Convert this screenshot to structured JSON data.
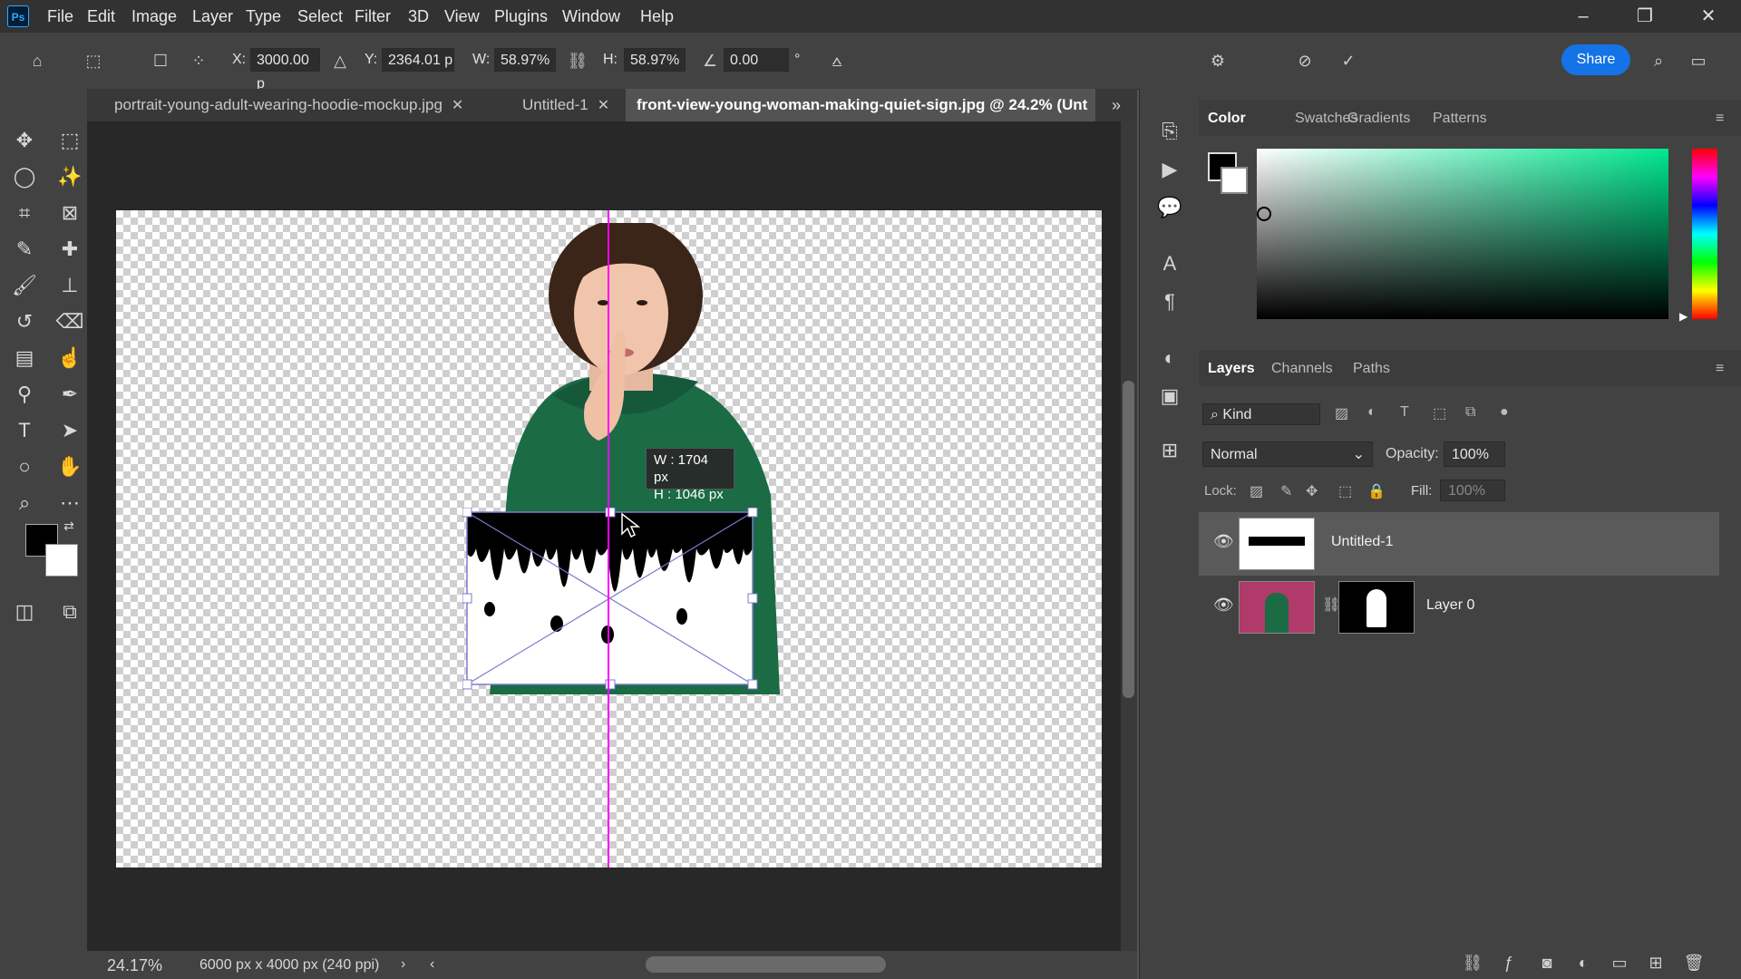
{
  "app": {
    "logo": "Ps"
  },
  "menu": [
    "File",
    "Edit",
    "Image",
    "Layer",
    "Type",
    "Select",
    "Filter",
    "3D",
    "View",
    "Plugins",
    "Window",
    "Help"
  ],
  "window_controls": {
    "minimize": "–",
    "restore": "❐",
    "close": "✕"
  },
  "options": {
    "x_label": "X:",
    "x_value": "3000.00 p",
    "y_label": "Y:",
    "y_value": "2364.01 p",
    "w_label": "W:",
    "w_value": "58.97%",
    "h_label": "H:",
    "h_value": "58.97%",
    "angle_value": "0.00",
    "degree": "°",
    "share": "Share"
  },
  "tabs": [
    {
      "label": "portrait-young-adult-wearing-hoodie-mockup.jpg",
      "close": "✕"
    },
    {
      "label": "Untitled-1",
      "close": "✕"
    },
    {
      "label": "front-view-young-woman-making-quiet-sign.jpg @ 24.2% (Unt"
    }
  ],
  "canvas": {
    "tooltip_w": "W :  1704 px",
    "tooltip_h": "H :  1046 px"
  },
  "status": {
    "zoom": "24.17%",
    "doc_info": "6000 px x 4000 px (240 ppi)"
  },
  "color_panel": {
    "tabs": [
      "Color",
      "Swatches",
      "Gradients",
      "Patterns"
    ]
  },
  "layers_panel": {
    "tabs": [
      "Layers",
      "Channels",
      "Paths"
    ],
    "kind_placeholder": "Kind",
    "blend_mode": "Normal",
    "opacity_label": "Opacity:",
    "opacity_value": "100%",
    "lock_label": "Lock:",
    "fill_label": "Fill:",
    "fill_value": "100%",
    "layers": [
      {
        "name": "Untitled-1"
      },
      {
        "name": "Layer 0"
      }
    ]
  },
  "colors": {
    "accent": "#1473e6",
    "guide": "#ff00ff",
    "hoodie": "#1b6b45"
  }
}
